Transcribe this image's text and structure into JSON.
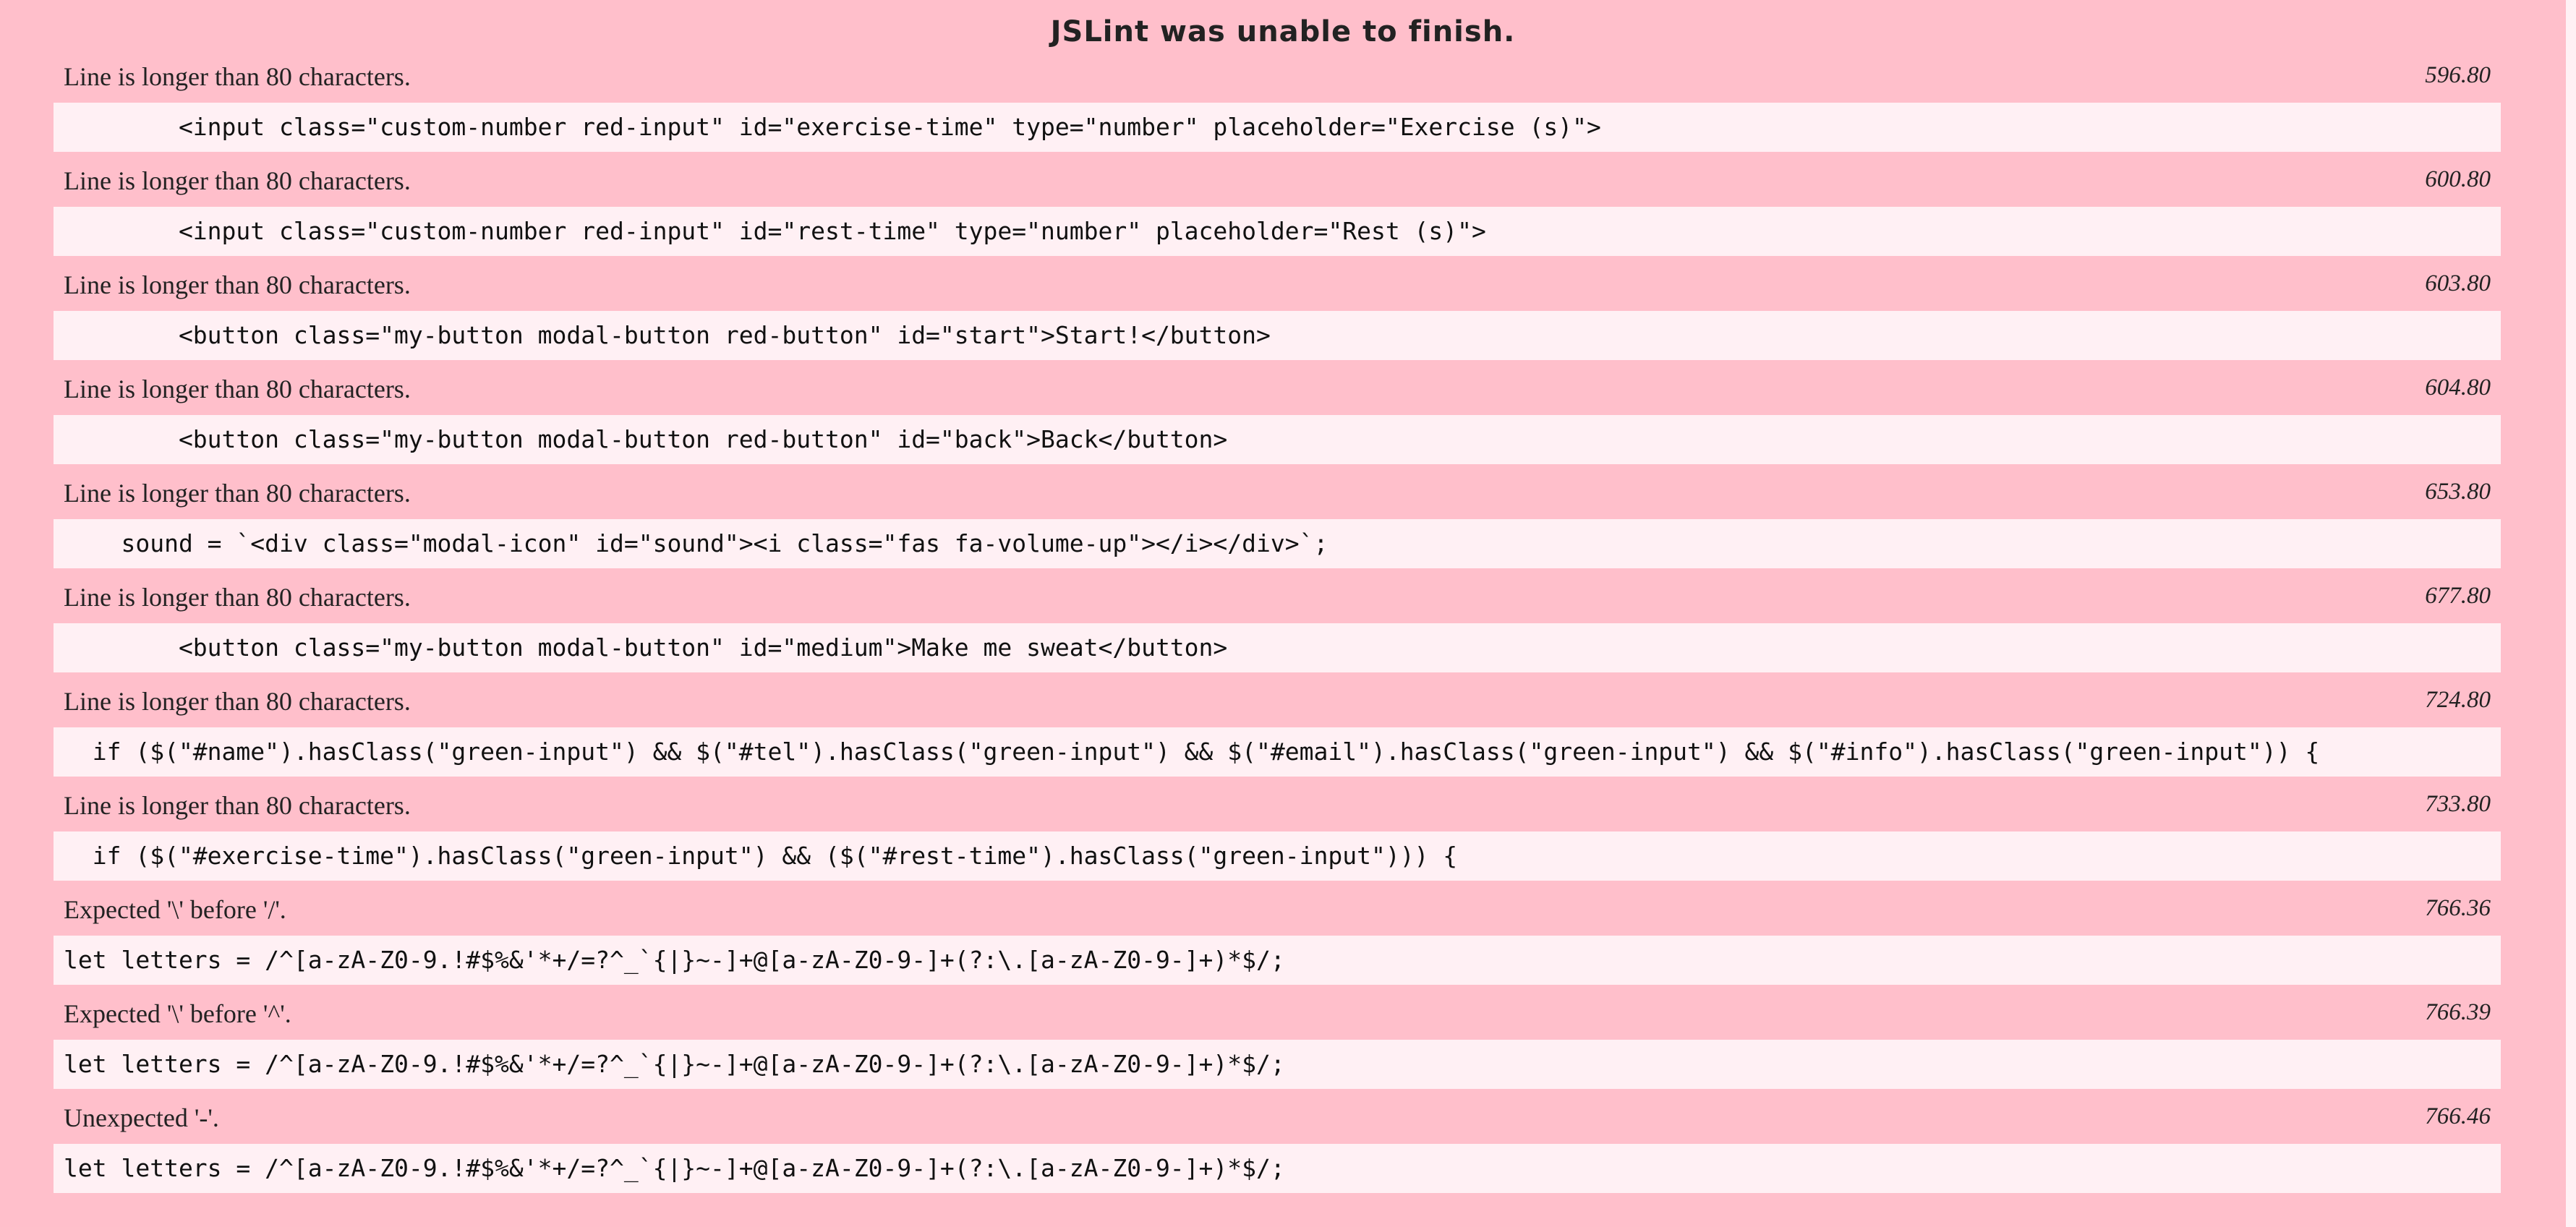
{
  "report": {
    "title": "JSLint was unable to finish.",
    "warnings": [
      {
        "message": "Line is longer than 80 characters.",
        "location": "596.80",
        "code": "        <input class=\"custom-number red-input\" id=\"exercise-time\" type=\"number\" placeholder=\"Exercise (s)\">"
      },
      {
        "message": "Line is longer than 80 characters.",
        "location": "600.80",
        "code": "        <input class=\"custom-number red-input\" id=\"rest-time\" type=\"number\" placeholder=\"Rest (s)\">"
      },
      {
        "message": "Line is longer than 80 characters.",
        "location": "603.80",
        "code": "        <button class=\"my-button modal-button red-button\" id=\"start\">Start!</button>"
      },
      {
        "message": "Line is longer than 80 characters.",
        "location": "604.80",
        "code": "        <button class=\"my-button modal-button red-button\" id=\"back\">Back</button>"
      },
      {
        "message": "Line is longer than 80 characters.",
        "location": "653.80",
        "code": "    sound = `<div class=\"modal-icon\" id=\"sound\"><i class=\"fas fa-volume-up\"></i></div>`;"
      },
      {
        "message": "Line is longer than 80 characters.",
        "location": "677.80",
        "code": "        <button class=\"my-button modal-button\" id=\"medium\">Make me sweat</button>"
      },
      {
        "message": "Line is longer than 80 characters.",
        "location": "724.80",
        "code": "  if ($(\"#name\").hasClass(\"green-input\") && $(\"#tel\").hasClass(\"green-input\") && $(\"#email\").hasClass(\"green-input\") && $(\"#info\").hasClass(\"green-input\")) {"
      },
      {
        "message": "Line is longer than 80 characters.",
        "location": "733.80",
        "code": "  if ($(\"#exercise-time\").hasClass(\"green-input\") && ($(\"#rest-time\").hasClass(\"green-input\"))) {"
      },
      {
        "message": "Expected '\\' before '/'.",
        "location": "766.36",
        "code": "let letters = /^[a-zA-Z0-9.!#$%&'*+/=?^_`{|}~-]+@[a-zA-Z0-9-]+(?:\\.[a-zA-Z0-9-]+)*$/;"
      },
      {
        "message": "Expected '\\' before '^'.",
        "location": "766.39",
        "code": "let letters = /^[a-zA-Z0-9.!#$%&'*+/=?^_`{|}~-]+@[a-zA-Z0-9-]+(?:\\.[a-zA-Z0-9-]+)*$/;"
      },
      {
        "message": "Unexpected '-'.",
        "location": "766.46",
        "code": "let letters = /^[a-zA-Z0-9.!#$%&'*+/=?^_`{|}~-]+@[a-zA-Z0-9-]+(?:\\.[a-zA-Z0-9-]+)*$/;"
      }
    ]
  },
  "colors": {
    "panel_bg": "#ffbfcb",
    "code_bg": "#fff0f4",
    "text": "#222222"
  }
}
